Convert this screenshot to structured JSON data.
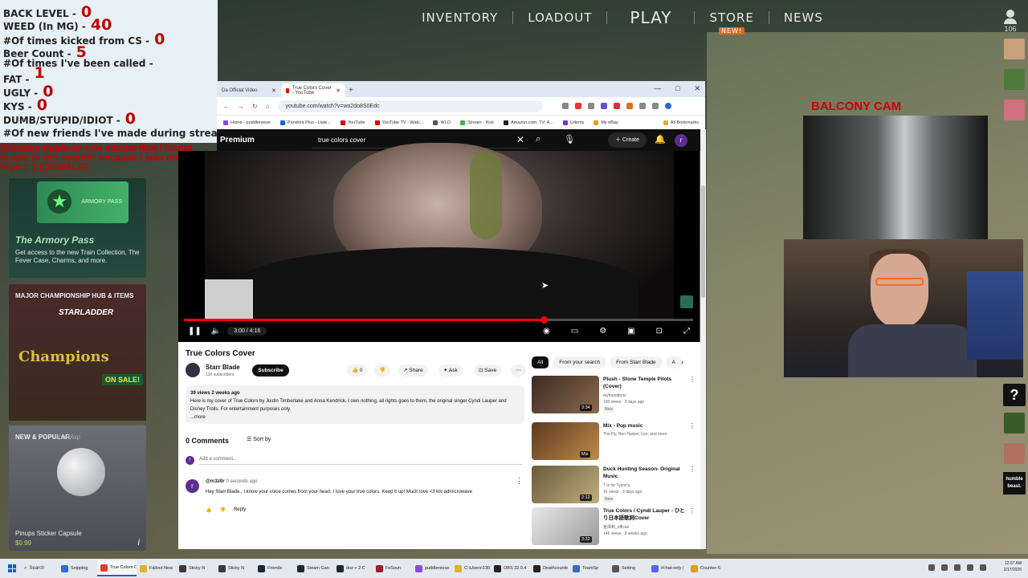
{
  "game": {
    "nav": {
      "inventory": "INVENTORY",
      "loadout": "LOADOUT",
      "play": "PLAY",
      "store": "STORE",
      "store_badge": "NEW!",
      "news": "NEWS"
    },
    "online_count": "106"
  },
  "counter": {
    "rows": [
      {
        "label": "BACK LEVEL -",
        "value": "0"
      },
      {
        "label": "WEED (In MG) -",
        "value": "40"
      },
      {
        "label": "#Of times kicked from CS -",
        "value": "0"
      },
      {
        "label": "Beer Count -",
        "value": "5"
      },
      {
        "label": "#Of times I've been called -",
        "value": ""
      },
      {
        "label": "FAT -",
        "value": "1"
      },
      {
        "label": "UGLY -",
        "value": "0"
      },
      {
        "label": "KYS -",
        "value": "0"
      },
      {
        "label": "DUMB/STUPID/IDIOT -",
        "value": "0"
      },
      {
        "label": "#Of new friends I've made during stream -",
        "value": "0"
      }
    ],
    "note": "Mistakes made on last stream that I forgot to add to the counter because I was too high = 1 (OSWALD)"
  },
  "left_panels": {
    "armory": {
      "title": "The Armory Pass",
      "text": "Get access to the new Train Collection, The Fever Case, Charms, and more."
    },
    "major": {
      "title": "MAJOR CHAMPIONSHIP HUB & ITEMS",
      "logo": "STARLADDER",
      "champions": "Champions",
      "sale": "ON SALE!"
    },
    "new": {
      "title": "NEW & POPULAR",
      "subtitle": "Non-Map",
      "name": "Pinups Sticker Capsule",
      "price": "$0.99",
      "info": "i"
    }
  },
  "cam": {
    "label": "BALCONY CAM"
  },
  "browser": {
    "tabs": [
      {
        "label": "Da Official Video"
      },
      {
        "label": "True Colors Cover - YouTube"
      }
    ],
    "newtab": "+",
    "url": "youtube.com/watch?v=wo2do8S0Edc",
    "bookmarks": [
      {
        "label": "Home - puddlereese",
        "color": "#8a4bd6"
      },
      {
        "label": "Pandora Plus - Liste...",
        "color": "#1a63d6"
      },
      {
        "label": "YouTube",
        "color": "#e00000"
      },
      {
        "label": "YouTube TV - Watc...",
        "color": "#e00000"
      },
      {
        "label": "WLO",
        "color": "#555555"
      },
      {
        "label": "Stream - Kick",
        "color": "#3bb34a"
      },
      {
        "label": "Amazon.com: TV: A...",
        "color": "#222222"
      },
      {
        "label": "Udemy",
        "color": "#7c2fd0"
      },
      {
        "label": "My eBay",
        "color": "#e0a020"
      }
    ],
    "all_bookmarks": "All Bookmarks"
  },
  "youtube": {
    "brand": "Premium",
    "search_value": "true colors cover",
    "create": "Create",
    "avatar_letter": "r",
    "player": {
      "time": "3:00 / 4:16",
      "progress": 0.706
    },
    "video": {
      "title": "True Colors Cover",
      "channel": "Starr Blade",
      "subs": "132 subscribers",
      "subscribe": "Subscribe",
      "likes": "0",
      "share": "Share",
      "ask": "Ask",
      "save": "Save",
      "views": "39 views",
      "age": "2 weeks ago",
      "description": "Here is my cover of True Colors by Justin Timberlake and Anna Kendrick. I own nothing, all rights goes to them, the original singer Cyndi Lauper and Disney Trolls. For entertainment purposes only.",
      "more": "...more"
    },
    "comments": {
      "count_label": "0 Comments",
      "sort": "Sort by",
      "add_placeholder": "Add a comment...",
      "items": [
        {
          "user": "@rc3z0r",
          "time": "0 seconds ago",
          "text": "Hey Starr Blade.. I know your voice comes from your heart. I love your true colors. Keep it up! Much love <3 ktv admicrowave",
          "reply": "Reply"
        }
      ]
    },
    "chips": [
      "All",
      "From your search",
      "From Starr Blade",
      "A"
    ],
    "recommendations": [
      {
        "title": "Plush - Stone Temple Pilots (Cover)",
        "channel": "myfriendtony",
        "meta": "100 views · 3 days ago",
        "tag": "New",
        "duration": "3:34"
      },
      {
        "title": "Mix - Pop music",
        "channel": "The Fly, Ben Harper, Len, and more",
        "meta": "",
        "tag": "",
        "duration": "Mix"
      },
      {
        "title": "Duck Hunting Season- Original Music",
        "channel": "T is for Tyson's",
        "meta": "16 views · 3 days ago",
        "tag": "New",
        "duration": "2:12"
      },
      {
        "title": "True Colors / Cyndi Lauper - ひとり日本語歌詞Cover",
        "channel": "宮澤和_official",
        "meta": "146 views · 2 weeks ago",
        "tag": "",
        "duration": "3:32"
      }
    ]
  },
  "taskbar": {
    "search": "Search",
    "items": [
      {
        "label": "Snipping",
        "color": "#2b6fd6"
      },
      {
        "label": "True Colors C",
        "color": "#e33b2e"
      },
      {
        "label": "Fallout New",
        "color": "#e0b030"
      },
      {
        "label": "Sticky N",
        "color": "#3a3a3a"
      },
      {
        "label": "Sticky N",
        "color": "#3a3a3a"
      },
      {
        "label": "Friends",
        "color": "#1b2838"
      },
      {
        "label": "Steam Gan",
        "color": "#1b2838"
      },
      {
        "label": "doz + 2 C",
        "color": "#1b2838"
      },
      {
        "label": "FxSoun",
        "color": "#9a1b2e"
      },
      {
        "label": "puddlereese",
        "color": "#8a4bd6"
      },
      {
        "label": "C:\\Users\\130",
        "color": "#e0b030"
      },
      {
        "label": "OBS 32.0.4",
        "color": "#222222"
      },
      {
        "label": "Deathcounte",
        "color": "#222222"
      },
      {
        "label": "TeamSp",
        "color": "#3b6bbf"
      },
      {
        "label": "Setting",
        "color": "#555555"
      },
      {
        "label": "#chat-only |",
        "color": "#5865f2"
      },
      {
        "label": "Counter-S",
        "color": "#e09a20"
      }
    ],
    "time": "12:07 AM",
    "date": "2/17/2026"
  },
  "right_bar": {
    "help": "?",
    "humble": "humble beast."
  }
}
